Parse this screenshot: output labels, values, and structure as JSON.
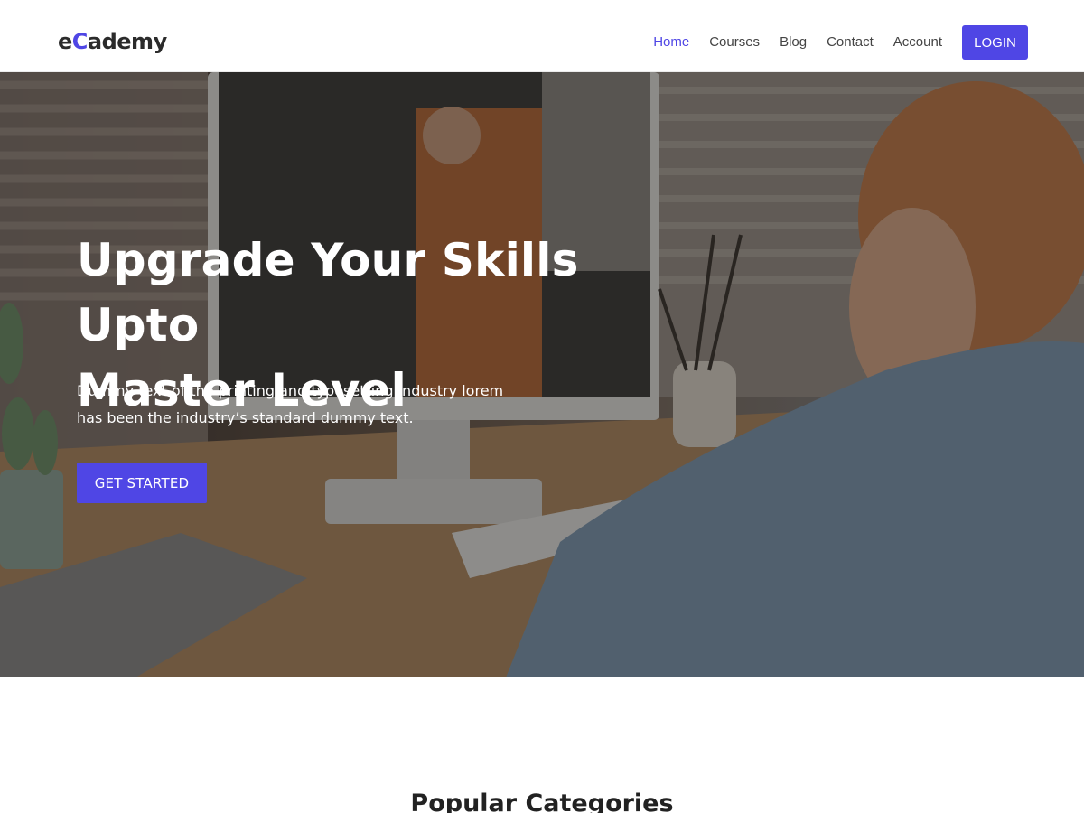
{
  "brand": {
    "prefix": "e",
    "accent": "C",
    "suffix": "ademy",
    "accent_color": "#4f46e5"
  },
  "nav": {
    "items": [
      {
        "label": "Home",
        "active": true
      },
      {
        "label": "Courses",
        "active": false
      },
      {
        "label": "Blog",
        "active": false
      },
      {
        "label": "Contact",
        "active": false
      },
      {
        "label": "Account",
        "active": false
      }
    ],
    "login_label": "LOGIN"
  },
  "hero": {
    "title_line1": "Upgrade Your Skills Upto",
    "title_line2": "Master Level",
    "subtitle_line1": "Dummy text of the printing and typesetting industry lorem",
    "subtitle_line2": "has been the industry’s standard dummy text.",
    "cta_label": "GET STARTED",
    "image_description_icon": "hero-photo"
  },
  "section": {
    "title": "Popular Categories"
  }
}
